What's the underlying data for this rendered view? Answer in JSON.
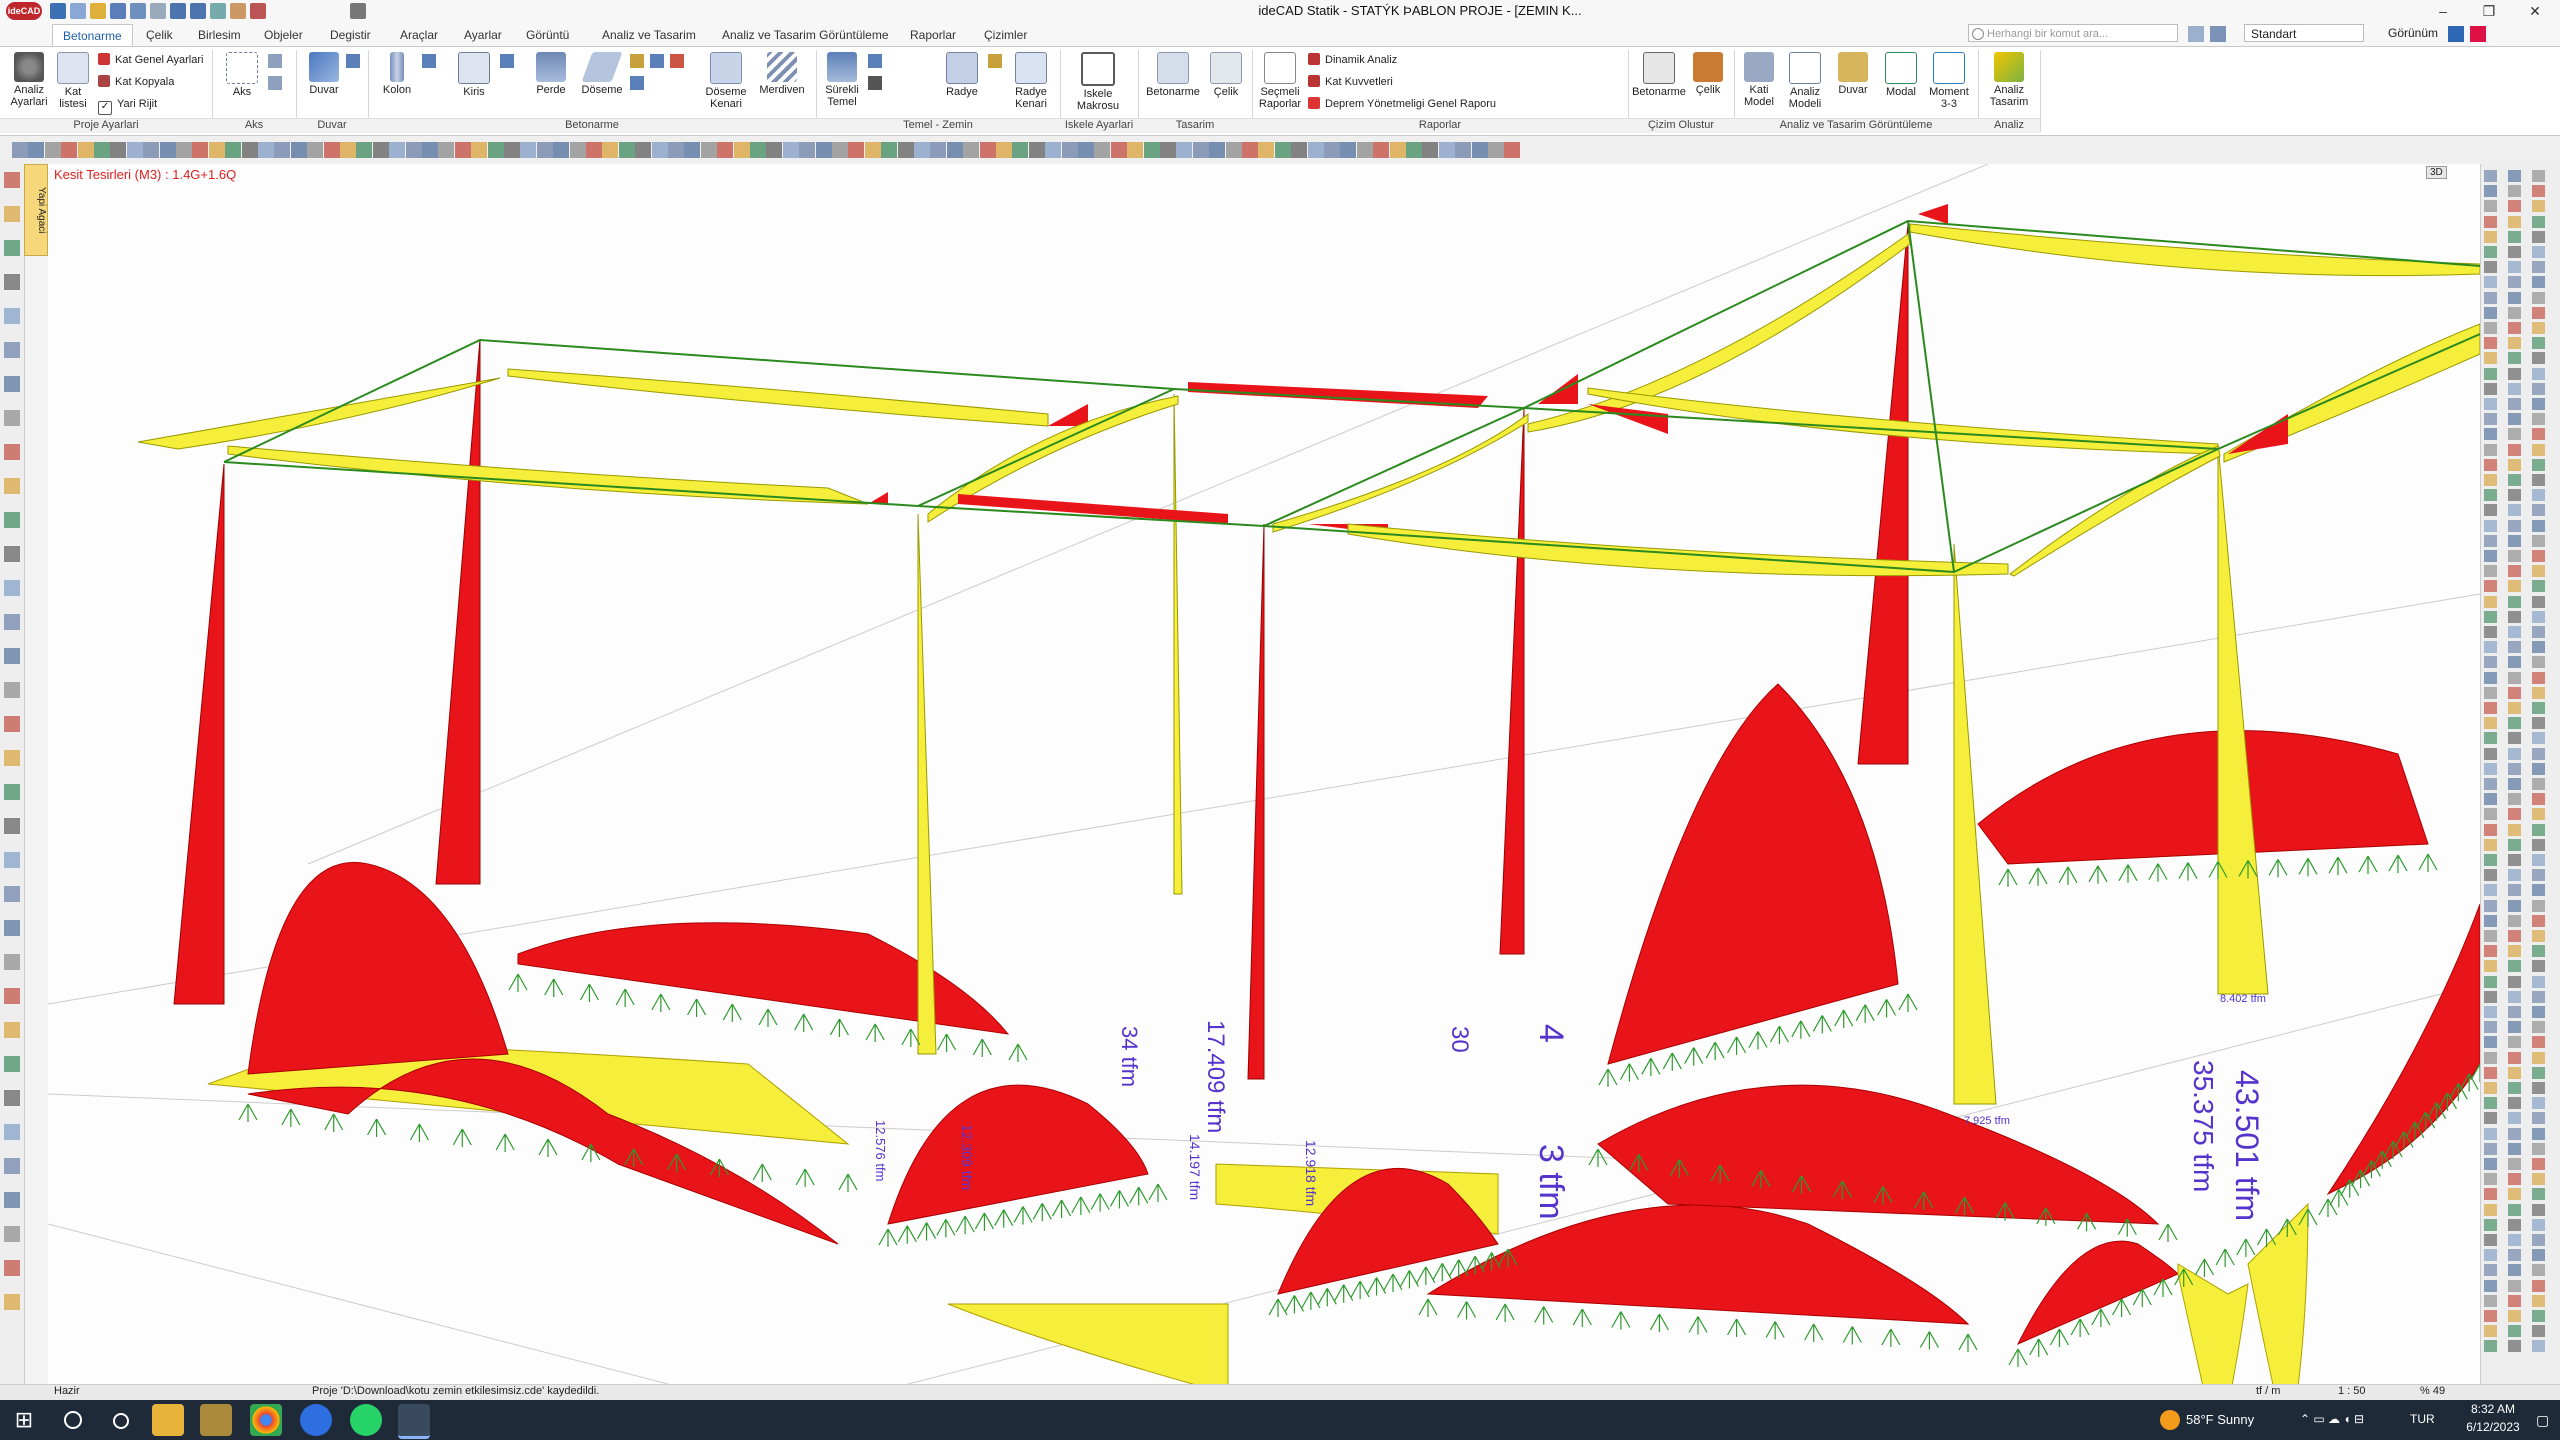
{
  "window": {
    "logo": "ideCAD",
    "title": "ideCAD Statik - STATÝK ÞABLON PROJE - [ZEMIN K...",
    "controls": [
      "–",
      "❐",
      "✕"
    ]
  },
  "ribbon_tabs": [
    "Betonarme",
    "Çelik",
    "Birlesim",
    "Objeler",
    "Degistir",
    "Araçlar",
    "Ayarlar",
    "Görüntü",
    "Analiz ve Tasarim",
    "Analiz ve Tasarim Görüntüleme",
    "Raporlar",
    "Çizimler"
  ],
  "active_tab": "Betonarme",
  "search": {
    "placeholder": "Herhangi bir komut ara..."
  },
  "standart_select": "Standart",
  "gorunum_menu": "Görünüm",
  "ribbon": {
    "proje_ayarlari": {
      "label": "Proje Ayarlari",
      "analiz_ayarlari": "Analiz Ayarlari",
      "kat_listesi": "Kat listesi",
      "kat_genel_ayarlari": "Kat Genel Ayarlari",
      "kat_kopyala": "Kat Kopyala",
      "yari_rijit": "Yari Rijit"
    },
    "aks": {
      "label": "Aks",
      "aks_button": "Aks"
    },
    "duvar": {
      "label": "Duvar",
      "duvar_button": "Duvar"
    },
    "betonarme": {
      "label": "Betonarme",
      "kolon": "Kolon",
      "kiris": "Kiris",
      "perde": "Perde",
      "doseme": "Döseme",
      "doseme_kenari": "Döseme Kenari",
      "merdiven": "Merdiven"
    },
    "temel": {
      "label": "Temel - Zemin",
      "surekli_temel": "Sürekli Temel",
      "radye": "Radye",
      "radye_kenari": "Radye Kenari"
    },
    "iskele": {
      "label": "Iskele Ayarlari",
      "iskele_makrosu": "Iskele Makrosu"
    },
    "tasarim": {
      "label": "Tasarim",
      "betonarme": "Betonarme",
      "celik": "Çelik"
    },
    "raporlar": {
      "label": "Raporlar",
      "secmeli_raporlar": "Seçmeli Raporlar",
      "dinamik_analiz": "Dinamik Analiz",
      "kat_kuvvetleri": "Kat Kuvvetleri",
      "deprem_raporu": "Deprem Yönetmeligi Genel Raporu"
    },
    "cizim": {
      "label": "Çizim Olustur",
      "betonarme": "Betonarme",
      "celik": "Çelik"
    },
    "analiz_gor": {
      "label": "Analiz ve Tasarim Görüntüleme",
      "kati_model": "Kati Model",
      "analiz_modeli": "Analiz Modeli",
      "duvar": "Duvar",
      "modal": "Modal",
      "moment": "Moment 3-3"
    },
    "analiz": {
      "label": "Analiz",
      "analiz_tasarim": "Analiz Tasarim"
    }
  },
  "left_panel_tab": "Yapi Agaci",
  "viewport": {
    "section_label": "Kesit Tesirleri (M3) : 1.4G+1.6Q",
    "view_mode": "3D",
    "colors": {
      "positive": "#e8141a",
      "negative": "#f5ee3a",
      "beam": "#2b8a1e",
      "support": "#2e9a2e",
      "value_text": "#5533cc"
    },
    "value_labels": [
      "17.409 tfm",
      "43.501 tfm",
      "35.375 tfm",
      "12.309 tfm",
      "12.918 tfm",
      "14.197 tfm",
      "12.576 tfm",
      "8.402 tfm",
      "7.925 tfm",
      "4",
      "3 tfm",
      "30",
      "34 tfm"
    ]
  },
  "status": {
    "ready": "Hazir",
    "message": "Proje 'D:\\Download\\kotu zemin etkilesimsiz.cde' kaydedildi.",
    "unit": "tf / m",
    "scale": "1 : 50",
    "zoom": "% 49"
  },
  "taskbar": {
    "weather": "58°F  Sunny",
    "language": "TUR",
    "time": "8:32 AM",
    "date": "6/12/2023"
  }
}
